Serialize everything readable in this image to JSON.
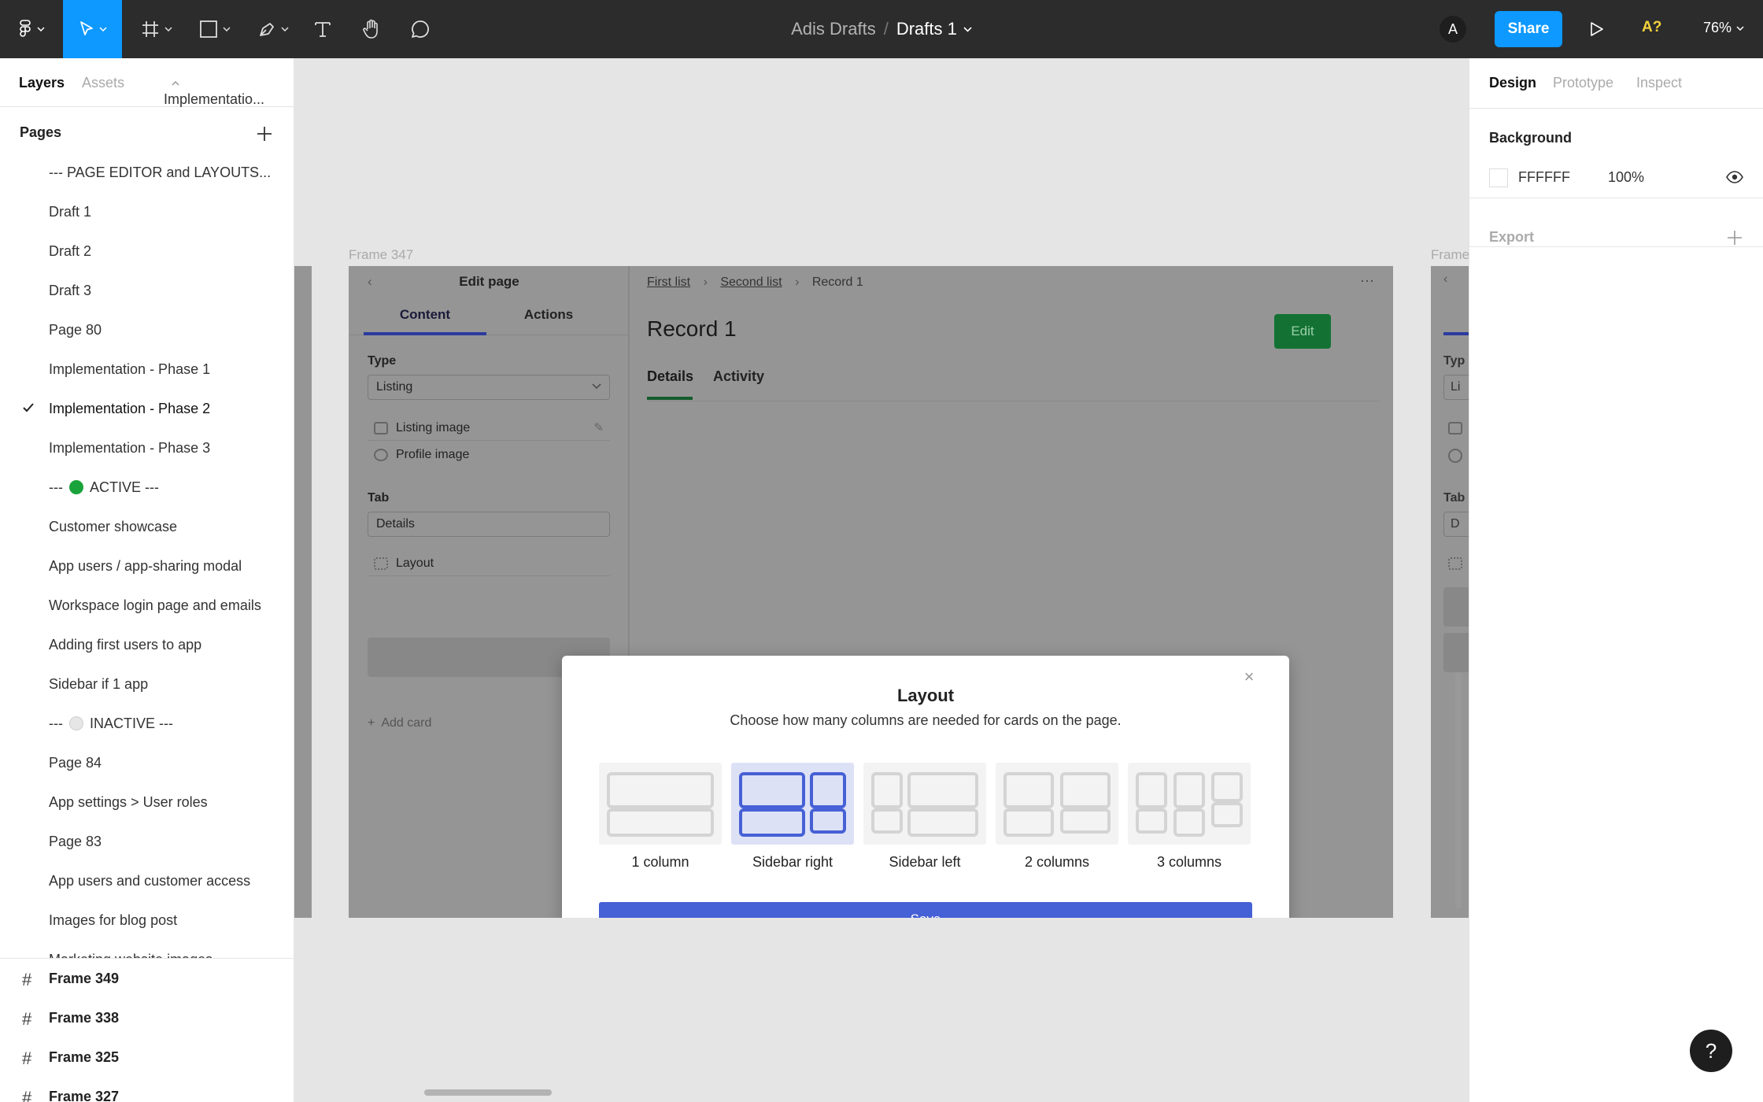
{
  "toolbar": {
    "project": "Adis Drafts",
    "separator": "/",
    "file_name": "Drafts 1",
    "avatar_initial": "A",
    "share_label": "Share",
    "font_warning": "A?",
    "zoom": "76%"
  },
  "left_panel": {
    "tabs": {
      "layers": "Layers",
      "assets": "Assets",
      "page_selector": "Implementatio..."
    },
    "pages_header": "Pages",
    "pages": [
      {
        "label": "--- PAGE EDITOR and LAYOUTS..."
      },
      {
        "label": "Draft 1"
      },
      {
        "label": "Draft 2"
      },
      {
        "label": "Draft 3"
      },
      {
        "label": "Page 80"
      },
      {
        "label": "Implementation - Phase 1"
      },
      {
        "label": "Implementation - Phase 2",
        "current": true
      },
      {
        "label": "Implementation - Phase 3"
      },
      {
        "label_prefix": "---",
        "dot_color": "#1aa33a",
        "label": "ACTIVE ---"
      },
      {
        "label": "Customer showcase"
      },
      {
        "label": "App users / app-sharing modal"
      },
      {
        "label": "Workspace login page and emails"
      },
      {
        "label": "Adding first users to app"
      },
      {
        "label": "Sidebar if 1 app"
      },
      {
        "label_prefix": "---",
        "dot_color": "#e6e6e6",
        "label": "INACTIVE ---"
      },
      {
        "label": "Page 84"
      },
      {
        "label": "App settings > User roles"
      },
      {
        "label": "Page 83"
      },
      {
        "label": "App users and customer access"
      },
      {
        "label": "Images for blog post"
      },
      {
        "label": "Marketing website images"
      }
    ],
    "frames": [
      {
        "label": "Frame 349"
      },
      {
        "label": "Frame 338"
      },
      {
        "label": "Frame 325"
      },
      {
        "label": "Frame 327"
      }
    ]
  },
  "canvas": {
    "frame_label": "Frame 347",
    "right_frame_label": "Frame",
    "edit_panel": {
      "back": "‹",
      "title": "Edit page",
      "tabs": {
        "content": "Content",
        "actions": "Actions"
      },
      "type_label": "Type",
      "type_value": "Listing",
      "fields": [
        {
          "label": "Listing image"
        },
        {
          "label": "Profile image"
        }
      ],
      "tab_label": "Tab",
      "tab_value": "Details",
      "layout_row": "Layout",
      "add_card": "Add card"
    },
    "record": {
      "breadcrumbs": [
        "First list",
        "Second list",
        "Record 1"
      ],
      "more": "···",
      "title": "Record 1",
      "edit_label": "Edit",
      "tabs": {
        "details": "Details",
        "activity": "Activity"
      }
    },
    "right_frame": {
      "type_label_partial": "Typ",
      "type_value_partial": "Li",
      "tab_label_partial": "Tab",
      "tab_value_partial": "D"
    },
    "modal": {
      "title": "Layout",
      "subtitle": "Choose how many columns are needed for cards on the page.",
      "options": [
        {
          "label": "1 column",
          "selected": false
        },
        {
          "label": "Sidebar right",
          "selected": true
        },
        {
          "label": "Sidebar left",
          "selected": false
        },
        {
          "label": "2 columns",
          "selected": false
        },
        {
          "label": "3 columns",
          "selected": false
        }
      ],
      "save_label": "Save",
      "close": "×",
      "accent_color": "#4660d5"
    }
  },
  "right_panel": {
    "tabs": {
      "design": "Design",
      "prototype": "Prototype",
      "inspect": "Inspect"
    },
    "background_title": "Background",
    "background_hex": "FFFFFF",
    "background_opacity": "100%",
    "export_label": "Export",
    "help": "?"
  },
  "colors": {
    "toolbar_bg": "#2c2c2c",
    "accent_blue": "#0d99ff",
    "modal_primary": "#4660d5",
    "edit_green": "#137233"
  },
  "icons": {
    "toolbar": [
      "figma-menu-icon",
      "move-tool-icon",
      "frame-tool-icon",
      "shape-tool-icon",
      "pen-tool-icon",
      "text-tool-icon",
      "hand-tool-icon",
      "comment-tool-icon",
      "present-icon"
    ],
    "panels": [
      "add-page-icon",
      "checkmark-icon",
      "frame-hash-icon",
      "visibility-eye-icon",
      "add-export-icon",
      "help-icon",
      "close-icon"
    ]
  }
}
